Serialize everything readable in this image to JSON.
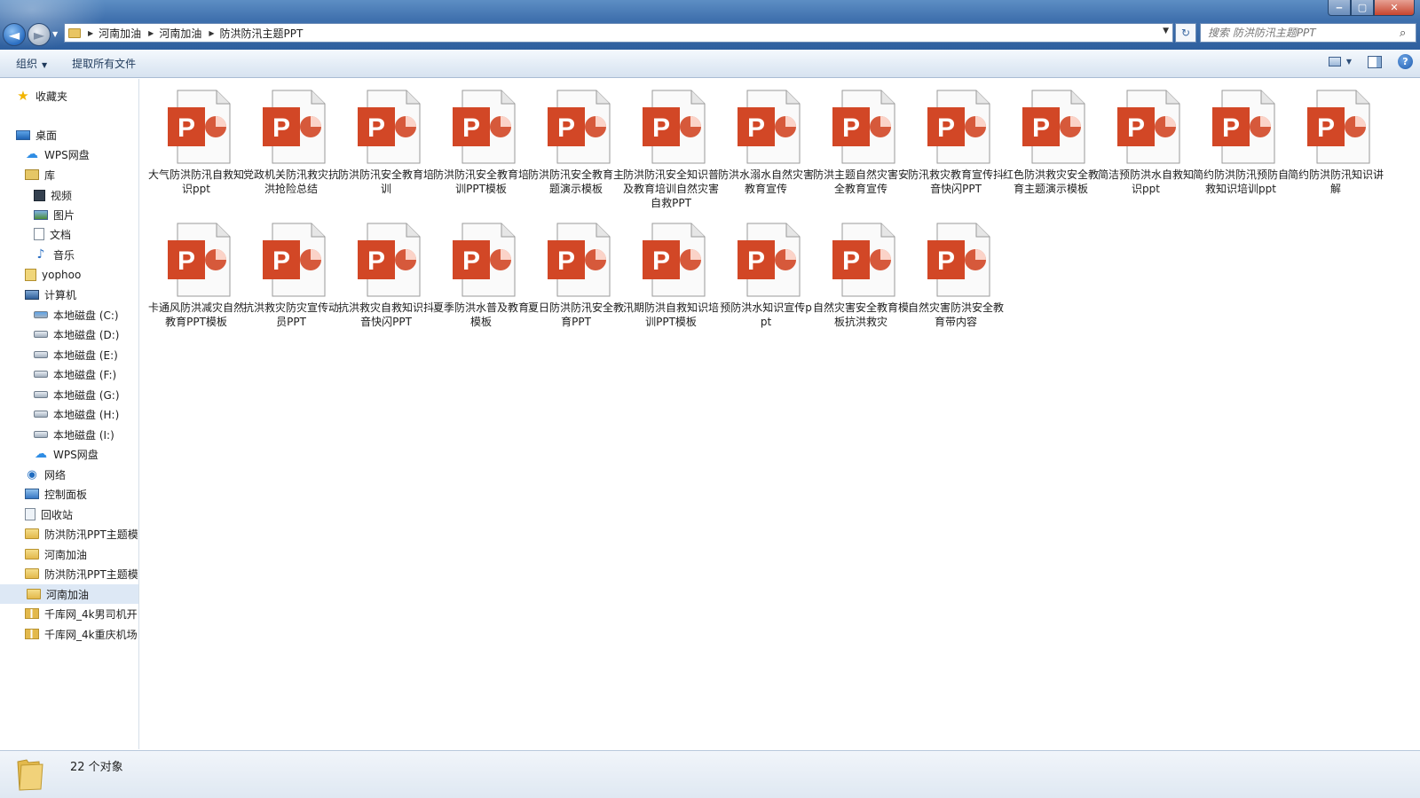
{
  "window": {
    "controls": {
      "minimize": "‒",
      "maximize": "▢",
      "close": "✕"
    }
  },
  "nav": {
    "back_glyph": "◄",
    "forward_glyph": "►",
    "history_glyph": "▼"
  },
  "address": {
    "breadcrumbs": [
      "河南加油",
      "河南加油",
      "防洪防汛主题PPT"
    ],
    "separator": "▶",
    "dropdown_glyph": "▼"
  },
  "refresh_glyph": "↻",
  "search": {
    "placeholder": "搜索 防洪防汛主题PPT",
    "icon": "search-icon"
  },
  "toolbar": {
    "organize_label": "组织",
    "extract_label": "提取所有文件",
    "caret": "▼",
    "help_label": "?"
  },
  "sidebar": {
    "items": [
      {
        "label": "收藏夹",
        "icon": "star-icon"
      },
      {
        "label": "桌面",
        "icon": "desktop-icon"
      },
      {
        "label": "WPS网盘",
        "icon": "cloud-icon"
      },
      {
        "label": "库",
        "icon": "library-icon"
      },
      {
        "label": "视频",
        "icon": "video-icon"
      },
      {
        "label": "图片",
        "icon": "picture-icon"
      },
      {
        "label": "文档",
        "icon": "document-icon"
      },
      {
        "label": "音乐",
        "icon": "music-icon"
      },
      {
        "label": "yophoo",
        "icon": "user-folder-icon"
      },
      {
        "label": "计算机",
        "icon": "computer-icon"
      },
      {
        "label": "本地磁盘 (C:)",
        "icon": "drive-c-icon"
      },
      {
        "label": "本地磁盘 (D:)",
        "icon": "drive-icon"
      },
      {
        "label": "本地磁盘 (E:)",
        "icon": "drive-icon"
      },
      {
        "label": "本地磁盘 (F:)",
        "icon": "drive-icon"
      },
      {
        "label": "本地磁盘 (G:)",
        "icon": "drive-icon"
      },
      {
        "label": "本地磁盘 (H:)",
        "icon": "drive-icon"
      },
      {
        "label": "本地磁盘 (I:)",
        "icon": "drive-icon"
      },
      {
        "label": "WPS网盘",
        "icon": "cloud-icon"
      },
      {
        "label": "网络",
        "icon": "network-icon"
      },
      {
        "label": "控制面板",
        "icon": "control-panel-icon"
      },
      {
        "label": "回收站",
        "icon": "recycle-bin-icon"
      },
      {
        "label": "防洪防汛PPT主题模",
        "icon": "folder-icon"
      },
      {
        "label": "河南加油",
        "icon": "folder-icon"
      },
      {
        "label": "防洪防汛PPT主题模",
        "icon": "folder-icon"
      },
      {
        "label": "河南加油",
        "icon": "folder-icon",
        "selected": true
      },
      {
        "label": "千库网_4k男司机开:",
        "icon": "zip-folder-icon"
      },
      {
        "label": "千库网_4k重庆机场:",
        "icon": "zip-folder-icon"
      }
    ]
  },
  "files": [
    {
      "name": "大气防洪防汛自救知识ppt"
    },
    {
      "name": "党政机关防汛救灾抗洪抢险总结"
    },
    {
      "name": "防洪防汛安全教育培训"
    },
    {
      "name": "防洪防汛安全教育培训PPT模板"
    },
    {
      "name": "防洪防汛安全教育主题演示模板"
    },
    {
      "name": "防洪防汛安全知识普及教育培训自然灾害自救PPT"
    },
    {
      "name": "防洪水溺水自然灾害教育宣传"
    },
    {
      "name": "防洪主题自然灾害安全教育宣传"
    },
    {
      "name": "防汛救灾教育宣传抖音快闪PPT"
    },
    {
      "name": "红色防洪救灾安全教育主题演示模板"
    },
    {
      "name": "简洁预防洪水自救知识ppt"
    },
    {
      "name": "简约防洪防汛预防自救知识培训ppt"
    },
    {
      "name": "简约防洪防汛知识讲解"
    },
    {
      "name": "卡通风防洪减灾自然教育PPT模板"
    },
    {
      "name": "抗洪救灾防灾宣传动员PPT"
    },
    {
      "name": "抗洪救灾自救知识抖音快闪PPT"
    },
    {
      "name": "夏季防洪水普及教育模板"
    },
    {
      "name": "夏日防洪防汛安全教育PPT"
    },
    {
      "name": "汛期防洪自救知识培训PPT模板"
    },
    {
      "name": "预防洪水知识宣传ppt"
    },
    {
      "name": "自然灾害安全教育模板抗洪救灾"
    },
    {
      "name": "自然灾害防洪安全教育带内容"
    }
  ],
  "ppt_icon": {
    "letter": "P",
    "accent": "#d24726",
    "icon": "powerpoint-file-icon"
  },
  "status": {
    "count_text": "22 个对象"
  }
}
